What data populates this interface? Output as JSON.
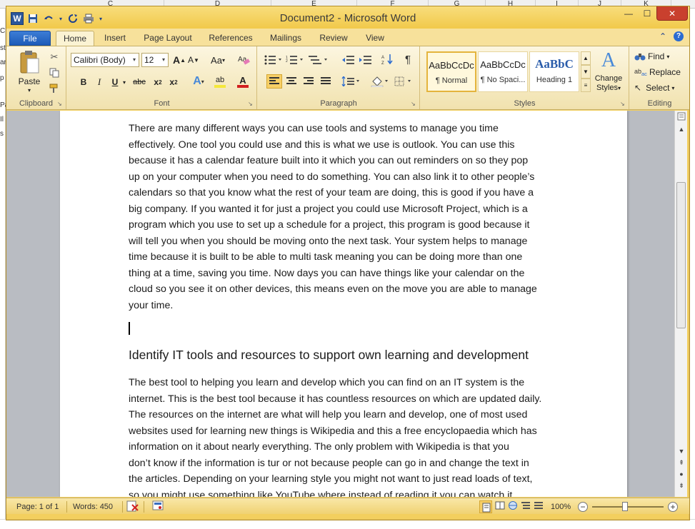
{
  "excel_bg": {
    "columns": [
      "C",
      "D",
      "E",
      "F",
      "G",
      "H",
      "I",
      "J",
      "K"
    ],
    "left_chars": [
      "C",
      "st",
      "ar",
      "p",
      "Pa",
      "Il",
      "s"
    ]
  },
  "window": {
    "title": "Document2  -  Microsoft Word",
    "qat_undo_arrow": "▾",
    "controls": {
      "minimize": "—",
      "maximize": "☐",
      "close": "✕"
    }
  },
  "tabs": {
    "file": "File",
    "items": [
      "Home",
      "Insert",
      "Page Layout",
      "References",
      "Mailings",
      "Review",
      "View"
    ],
    "active": "Home",
    "help_icon": "?"
  },
  "ribbon": {
    "clipboard": {
      "label": "Clipboard",
      "paste": "Paste",
      "paste_arrow": "▾"
    },
    "font": {
      "label": "Font",
      "font_name": "Calibri (Body)",
      "font_size": "12",
      "grow": "A",
      "shrink": "A",
      "change_case": "Aa",
      "bold": "B",
      "italic": "I",
      "underline": "U",
      "strikethrough": "abc",
      "subscript": "x",
      "superscript": "x",
      "text_effects": "A",
      "highlight": "ab",
      "font_color": "A",
      "font_color_hex": "#d21f1f",
      "highlight_hex": "#f5e83a"
    },
    "paragraph": {
      "label": "Paragraph"
    },
    "styles": {
      "label": "Styles",
      "items": [
        {
          "sample": "AaBbCcDc",
          "name": "¶ Normal"
        },
        {
          "sample": "AaBbCcDc",
          "name": "¶ No Spaci..."
        },
        {
          "sample": "AaBbC",
          "name": "Heading 1"
        }
      ],
      "change_styles_line1": "Change",
      "change_styles_line2": "Styles"
    },
    "editing": {
      "label": "Editing",
      "find": "Find",
      "replace": "Replace",
      "select": "Select"
    }
  },
  "document": {
    "paragraph1": [
      "There are many different ways you can use tools and systems to manage you time",
      "effectively. One tool you could use and this is what we use is outlook.  You can use this",
      "because it has a calendar feature built into it which you can out reminders on so they pop",
      "up on your computer when you need to do something.  You can also link it to other people’s",
      "calendars so that you know what the rest of your team are doing, this is good if you have a",
      "big company.  If you wanted it for just a project you could use Microsoft Project, which is a",
      "program which you use to set up a schedule for a project, this program is good because it",
      "will tell you when you should be moving onto the next task. Your system helps to manage",
      "time because it is built to be able to multi task meaning you can be doing more than one",
      "thing at a time, saving you time. Now days you can have things like your calendar on the",
      "cloud so you see it on other devices, this means even on the move you are able to manage",
      "your time."
    ],
    "heading": "Identify IT tools and resources to support own learning and development",
    "paragraph2": [
      "The best tool to helping you learn and develop which you can find on an IT system is the",
      "internet. This is the best tool because it has countless resources on which are updated daily.",
      "The resources on the internet are what will help you learn and develop, one of most used",
      "websites used for learning new things is Wikipedia and this a free encyclopaedia which has",
      "information on it about nearly everything. The only problem with Wikipedia is that you",
      "don’t know if the information is tur or not because people can go in and change the text in",
      "the articles. Depending on your learning style you might not want to just read loads of text,",
      "so you might use something like YouTube where instead of reading it you can watch it"
    ]
  },
  "statusbar": {
    "page": "Page: 1 of 1",
    "words": "Words: 450",
    "zoom": "100%",
    "zoom_out": "−",
    "zoom_in": "+",
    "zoom_level": 1.0
  }
}
